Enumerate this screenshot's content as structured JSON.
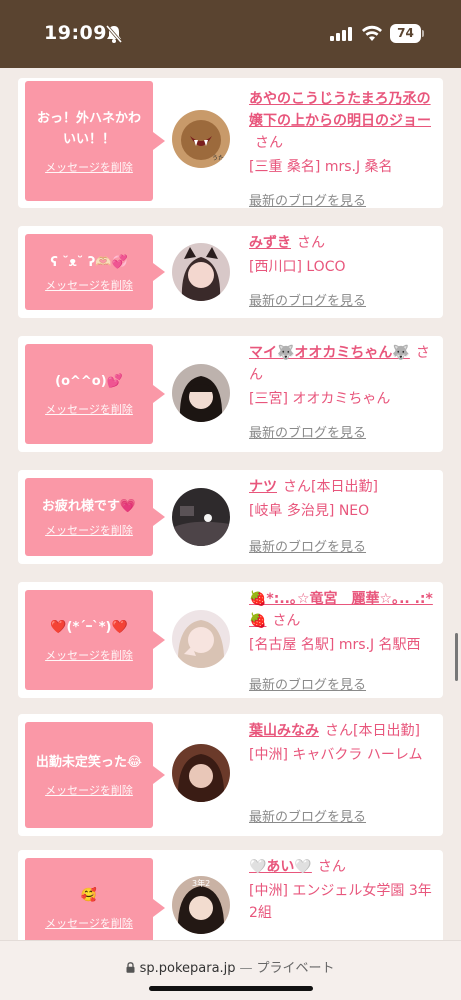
{
  "status": {
    "time": "19:09",
    "battery": "74"
  },
  "browser": {
    "url": "sp.pokepara.jp",
    "private_label": "プライベート"
  },
  "delete_label": "メッセージを削除",
  "honorific": "さん",
  "blog_label": "最新のブログを見る",
  "entries": [
    {
      "message": "おっ！外ハネかわいい！！",
      "name": "あやのこうじうたまろ乃氶の嬢下の上からの明日のジョー",
      "suffix": "",
      "shop": "[三重 桑名] mrs.J 桑名"
    },
    {
      "message": "ʕ ˘ᴥ˘ ʔ🫶🏻💞",
      "name": "みずき",
      "suffix": "",
      "shop": "[西川口] LOCO"
    },
    {
      "message": "(o^^o)💕",
      "name": "マイ🐺オオカミちゃん🐺",
      "suffix": "",
      "shop": "[三宮] オオカミちゃん"
    },
    {
      "message": "お疲れ様です💗",
      "name": "ナツ",
      "suffix": "[本日出勤]",
      "shop": "[岐阜 多治見] NEO"
    },
    {
      "message": "❤️(*´ｰ`*)❤️",
      "name": "🍓*:..｡☆竜宮　麗華☆｡.. .:*🍓",
      "suffix": "",
      "shop": "[名古屋 名駅] mrs.J 名駅西"
    },
    {
      "message": "出勤未定笑った😂",
      "name": "葉山みなみ",
      "suffix": "[本日出勤]",
      "shop": "[中洲] キャバクラ ハーレム"
    },
    {
      "message": "🥰",
      "name": "🤍あい🤍",
      "suffix": "",
      "shop": "[中洲] エンジェル女学園 3年2組"
    }
  ]
}
